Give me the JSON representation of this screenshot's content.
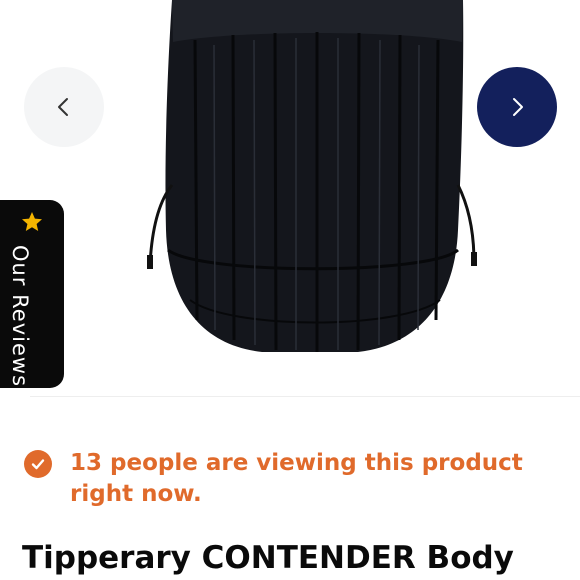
{
  "gallery": {
    "image_name": "vest-image",
    "prev_icon": "chevron-left-icon",
    "next_icon": "chevron-right-icon",
    "next_button_color": "#13205c"
  },
  "reviews_tab": {
    "label": "Our Reviews",
    "icon": "star-icon",
    "star_color": "#f4b400"
  },
  "viewers": {
    "icon": "check-circle-icon",
    "text": "13 people are viewing this product right now.",
    "color": "#e06a2b"
  },
  "product": {
    "title": "Tipperary CONTENDER Body"
  }
}
